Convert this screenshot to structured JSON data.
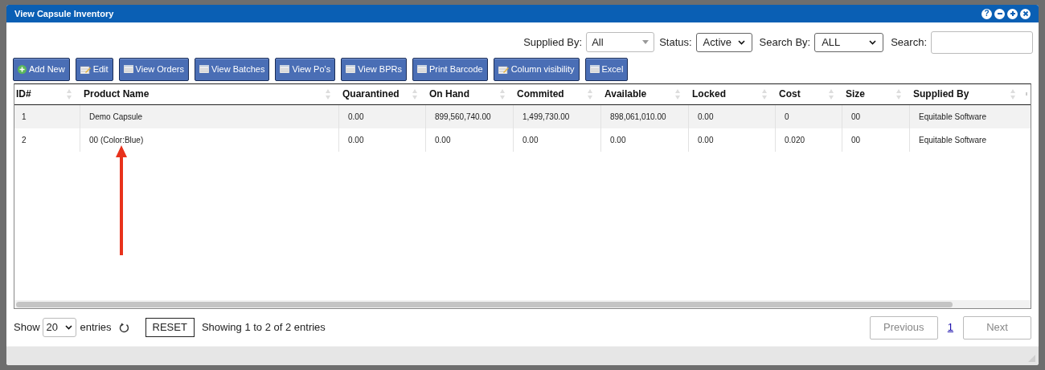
{
  "window": {
    "title": "View Capsule Inventory",
    "controls": [
      {
        "kind": "help",
        "label": "?"
      },
      {
        "kind": "minimize"
      },
      {
        "kind": "maximize"
      },
      {
        "kind": "close"
      }
    ]
  },
  "filters": [
    {
      "kind": "combo",
      "label": "Supplied By:",
      "value": "All"
    },
    {
      "kind": "select",
      "label": "Status:",
      "value": "Active"
    },
    {
      "kind": "select",
      "label": "Search By:",
      "value": "ALL"
    },
    {
      "kind": "text",
      "label": "Search:"
    }
  ],
  "toolbar": [
    {
      "label": "Add New",
      "kind": "add"
    },
    {
      "label": "Edit",
      "kind": "edit"
    },
    {
      "label": "View Orders",
      "kind": "view"
    },
    {
      "label": "View Batches",
      "kind": "view"
    },
    {
      "label": "View Po's",
      "kind": "view"
    },
    {
      "label": "View BPRs",
      "kind": "view"
    },
    {
      "label": "Print Barcode",
      "kind": "view"
    },
    {
      "label": "Column visibility",
      "kind": "edit"
    },
    {
      "label": "Excel",
      "kind": "view"
    }
  ],
  "table": {
    "columns": [
      "ID#",
      "Product Name",
      "Quarantined",
      "On Hand",
      "Commited",
      "Available",
      "Locked",
      "Cost",
      "Size",
      "Supplied By"
    ],
    "rows": [
      [
        "1",
        "Demo Capsule",
        "0.00",
        "899,560,740.00",
        "1,499,730.00",
        "898,061,010.00",
        "0.00",
        "0",
        "00",
        "Equitable Software"
      ],
      [
        "2",
        "00 (Color:Blue)",
        "0.00",
        "0.00",
        "0.00",
        "0.00",
        "0.00",
        "0.020",
        "00",
        "Equitable Software"
      ]
    ]
  },
  "footer": {
    "show_label": "Show",
    "page_size": "20",
    "entries_label": "entries",
    "reset": "RESET",
    "info": "Showing 1 to 2 of 2 entries",
    "pagination": [
      {
        "kind": "button",
        "label": "Previous",
        "disabled": true
      },
      {
        "kind": "page",
        "label": "1",
        "selected": true
      },
      {
        "kind": "button",
        "label": "Next",
        "disabled": true
      }
    ]
  }
}
